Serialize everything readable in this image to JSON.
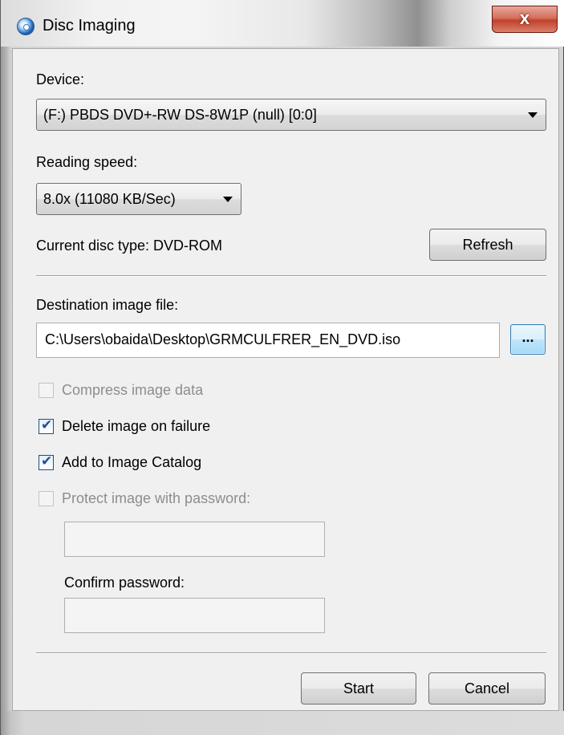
{
  "window": {
    "title": "Disc Imaging",
    "close_glyph": "x",
    "title_icon": "disc-imaging-icon"
  },
  "device": {
    "label": "Device:",
    "selected": "(F:) PBDS DVD+-RW DS-8W1P (null) [0:0]"
  },
  "reading_speed": {
    "label": "Reading speed:",
    "selected": "8.0x (11080 KB/Sec)"
  },
  "disc": {
    "current_type": "Current disc type: DVD-ROM",
    "refresh_label": "Refresh"
  },
  "destination": {
    "label": "Destination image file:",
    "path": "C:\\Users\\obaida\\Desktop\\GRMCULFRER_EN_DVD.iso",
    "browse_label": "..."
  },
  "options": [
    {
      "label": "Compress image data",
      "checked": false,
      "enabled": false
    },
    {
      "label": "Delete image on failure",
      "checked": true,
      "enabled": true
    },
    {
      "label": "Add to Image Catalog",
      "checked": true,
      "enabled": true
    },
    {
      "label": "Protect image with password:",
      "checked": false,
      "enabled": false
    }
  ],
  "password": {
    "value": "",
    "confirm_label": "Confirm password:",
    "confirm_value": ""
  },
  "actions": {
    "start_label": "Start",
    "cancel_label": "Cancel"
  },
  "colors": {
    "check_mark": "#2b4c8c",
    "close_button": "#c1412a",
    "browse_button": "#bee6fd"
  }
}
